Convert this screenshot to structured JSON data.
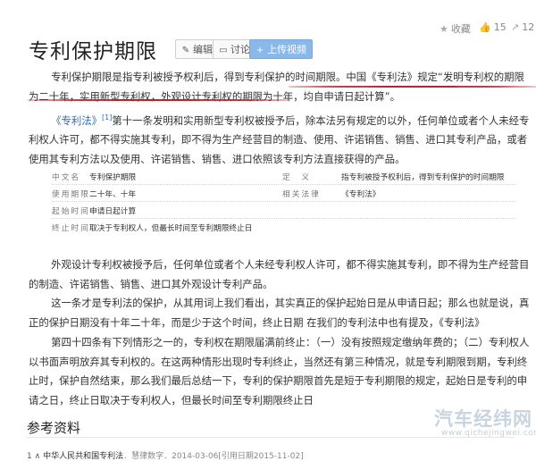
{
  "header": {
    "title": "专利保护期限",
    "edit_label": "编辑",
    "discuss_label": "讨论",
    "upload_label": "上传视频"
  },
  "top_actions": {
    "favorite_label": "收藏",
    "like_count": "15",
    "share_count": "12"
  },
  "paragraphs": {
    "p1": "专利保护期限是指专利被授予权利后，得到专利保护的时间期限。中国《专利法》规定“发明专利权的期限为二十年，实用新型专利权，外观设计专利权的期限为十年，均自申请日起计算”。",
    "p2_cite": "《专利法》",
    "p2_sup": "[1]",
    "p2_rest": "第十一条发明和实用新型专利权被授予后，除本法另有规定的以外，任何单位或者个人未经专利权人许可，都不得实施其专利，即不得为生产经营目的制造、使用、许诺销售、销售、进口其专利产品，或者使用其专利方法以及使用、许诺销售、销售、进口依照该专利方法直接获得的产品。",
    "p3": "外观设计专利权被授予后，任何单位或者个人未经专利权人许可，都不得实施其专利，即不得为生产经营目的制造、许诺销售、销售、进口其外观设计专利产品。",
    "p4": "这一条才是专利法的保护，从其用词上我们看出，其实真正的保护起始日是从申请日起；那么也就是说，真正的保护日期没有十年二十年，而是少于这个时间，终止日期 在我们的专利法中也有提及，《专利法》",
    "p5": "第四十四条有下列情形之一的，专利权在期限届满前终止：（一）没有按照规定缴纳年费的；（二）专利权人以书面声明放弃其专利权的。在这两种情形出现时专利终止，当然还有第三种情况，就是专利期限到期，专利终止时，保护自然结束，那么我们最后总结一下，专利的保护期限首先是短于专利期限的规定，起始日是专利的申请之日，终止日取决于专利权人，但最长时间至专利期限终止日"
  },
  "info_table": {
    "rows": [
      {
        "k1": "中文名",
        "v1": "专利保护期限",
        "k2": "定　义",
        "v2": "指专利被授予权利后，得到专利保护的时间期限"
      },
      {
        "k1": "使用期限",
        "v1": "二十年、十年",
        "k2": "相关法律",
        "v2": "《专利法》"
      },
      {
        "k1": "起始时间",
        "v1": "申请日起计算",
        "k2": "",
        "v2": ""
      },
      {
        "k1": "终止时间",
        "v1": "取决于专利权人，但最长时间至专利期限终止日",
        "k2": "",
        "v2": ""
      }
    ]
  },
  "references": {
    "title": "参考资料",
    "item_num": "1",
    "item_title": "中华人民共和国专利法",
    "item_meta": "．慧律数字．2014-03-06[引用日期2015-11-02]"
  },
  "watermark": {
    "name": "汽车经纬网",
    "url": "www.qichejingwei.com"
  },
  "colors": {
    "accent_line": "#b1262f",
    "link": "#2c6ec1",
    "primary_button": "#8bb8ea"
  }
}
